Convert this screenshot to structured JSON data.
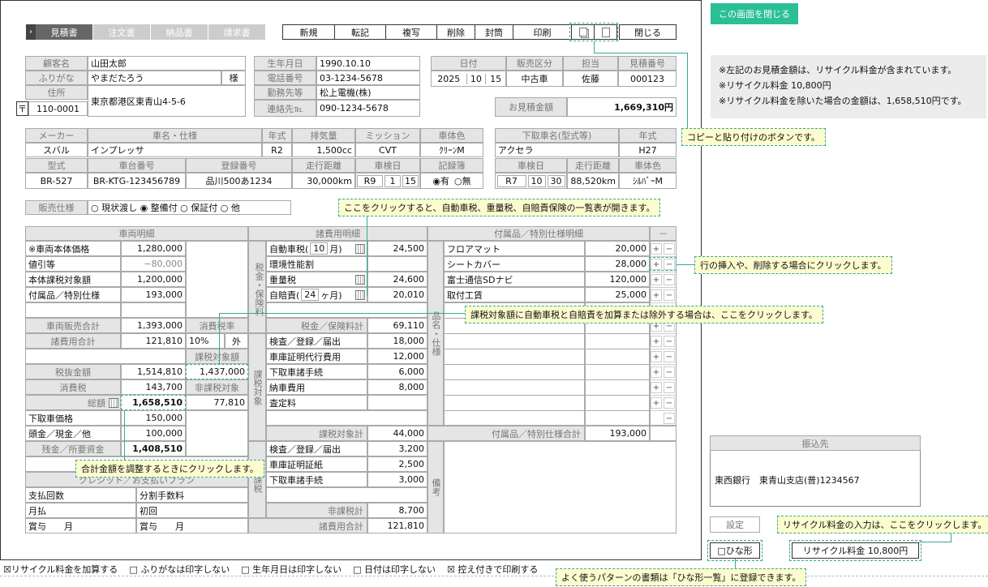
{
  "close_screen": "この画面を閉じる",
  "tabs": [
    "見積書",
    "注文書",
    "納品書",
    "請求書"
  ],
  "toolbar": [
    "新規",
    "転記",
    "複写",
    "削除",
    "封筒",
    "印刷",
    "閉じる"
  ],
  "customer": {
    "name_lbl": "顧客名",
    "name": "山田太郎",
    "kana_lbl": "ふりがな",
    "kana": "やまだたろう",
    "sama": "様",
    "addr_lbl": "住所",
    "zip_mark": "〒",
    "zip": "110-0001",
    "addr": "東京都港区東青山4-5-6",
    "birth_lbl": "生年月日",
    "birth": "1990.10.10",
    "tel_lbl": "電話番号",
    "tel": "03-1234-5678",
    "work_lbl": "勤務先等",
    "work": "松上電機(株)",
    "contact_lbl": "連絡先℡",
    "contact": "090-1234-5678"
  },
  "order": {
    "date_lbl": "日付",
    "y": "2025",
    "m": "10",
    "d": "15",
    "kubun_lbl": "販売区分",
    "kubun": "中古車",
    "tanto_lbl": "担当",
    "tanto": "佐藤",
    "no_lbl": "見積番号",
    "no": "000123",
    "amount_lbl": "お見積金額",
    "amount": "1,669,310円"
  },
  "car": {
    "maker_lbl": "メーカー",
    "maker": "スバル",
    "name_lbl": "車名・仕様",
    "name": "インプレッサ",
    "year_lbl": "年式",
    "year": "R2",
    "cc_lbl": "排気量",
    "cc": "1,500cc",
    "mission_lbl": "ミッション",
    "mission": "CVT",
    "color_lbl": "車体色",
    "color": "ｸﾘｰﾝM",
    "type_lbl": "型式",
    "type": "BR-527",
    "frame_lbl": "車台番号",
    "frame": "BR-KTG-123456789",
    "reg_lbl": "登録番号",
    "reg": "品川500あ1234",
    "km_lbl": "走行距離",
    "km": "30,000km",
    "inspect_lbl": "車検日",
    "ins_y": "R9",
    "ins_m": "1",
    "ins_d": "15",
    "rec_lbl": "記録簿",
    "rec_yes": "◉有",
    "rec_no": "○無"
  },
  "trade": {
    "name_lbl": "下取車名(型式等)",
    "name": "アクセラ",
    "year_lbl": "年式",
    "year": "H27",
    "ins_lbl": "車検日",
    "ins_y": "R7",
    "ins_m": "10",
    "ins_d": "30",
    "km_lbl": "走行距離",
    "km": "88,520km",
    "color_lbl": "車体色",
    "color": "ｼﾙﾊﾞｰM"
  },
  "sales": {
    "lbl": "販売仕様",
    "opts": "○ 現状渡し ◉ 整備付 ○ 保証付 ○ 他"
  },
  "head": {
    "car": "車両明細",
    "fee": "諸費用明細",
    "acc": "付属品／特別仕様明細",
    "minus": "－"
  },
  "carrows": [
    [
      "※車両本体価格",
      "1,280,000"
    ],
    [
      "値引等",
      "−80,000"
    ],
    [
      "本体課税対象額",
      "1,200,000"
    ],
    [
      "付属品／特別仕様",
      "193,000"
    ]
  ],
  "sum": {
    "hanbai_lbl": "車両販売合計",
    "hanbai": "1,393,000",
    "shohi_rate_lbl": "消費税率",
    "shohi_rate": "10%",
    "soto": "外",
    "shohiyo_lbl": "諸費用合計",
    "shohiyo": "121,810",
    "kazei_lbl": "課税対象額",
    "kazei": "1,437,000",
    "nuki_lbl": "税抜金額",
    "nuki": "1,514,810",
    "tax_lbl": "消費税",
    "tax": "143,700",
    "hikazei_lbl": "非課税対象",
    "hikazei": "77,810",
    "total_lbl": "総額",
    "total": "1,658,510",
    "shita_lbl": "下取車価格",
    "shita": "150,000",
    "atama_lbl": "頭金／現金／他",
    "atama": "100,000",
    "zan_lbl": "残金／所要資金",
    "zan": "1,408,510",
    "credit_lbl": "クレジット／お支払いプラン",
    "kaisu": "支払回数",
    "tesuryo": "分割手数料",
    "tsuki": "月払",
    "shokai": "初回",
    "shoyo1": "賞与　　月",
    "shoyo2": "賞与　　月"
  },
  "fees": {
    "side1": "税金・保険料",
    "jido": "自動車税(",
    "jido_m": "10",
    "jido_u": "月)",
    "jido_v": "24,500",
    "kankyo": "環境性能割",
    "juryo": "重量税",
    "juryo_v": "24,600",
    "jibai": "自賠責(",
    "jibai_m": "24",
    "jibai_u": "ヶ月)",
    "jibai_v": "20,010",
    "tax_total_lbl": "税金／保険料計",
    "tax_total": "69,110",
    "side2": "課税対象",
    "k1": "検査／登録／届出",
    "k1v": "18,000",
    "k2": "車庫証明代行費用",
    "k2v": "12,000",
    "k3": "下取車諸手続",
    "k3v": "6,000",
    "k4": "納車費用",
    "k4v": "8,000",
    "k5": "査定料",
    "kazei_total_lbl": "課税対象計",
    "kazei_total": "44,000",
    "side3": "非課税",
    "h1": "検査／登録／届出",
    "h1v": "3,200",
    "h2": "車庫証明証紙",
    "h2v": "2,500",
    "h3": "下取車諸手続",
    "h3v": "3,000",
    "hikazei_total_lbl": "非課税計",
    "hikazei_total": "8,700",
    "all_lbl": "諸費用合計",
    "all": "121,810"
  },
  "acc": {
    "side": "品名・仕様",
    "items": [
      [
        "フロアマット",
        "20,000"
      ],
      [
        "シートカバー",
        "28,000"
      ],
      [
        "富士通信SDナビ",
        "120,000"
      ],
      [
        "取付工賃",
        "25,000"
      ]
    ],
    "total_lbl": "付属品／特別仕様合計",
    "total": "193,000",
    "biko": "備考"
  },
  "notes": [
    "※左記のお見積金額は、リサイクル料金が含まれています。",
    "※リサイクル料金 10,800円",
    "※リサイクル料金を除いた場合の金額は、1,658,510円です。"
  ],
  "bank": {
    "lbl": "振込先",
    "text": "東西銀行　東青山支店(普)1234567"
  },
  "settei": "設定",
  "hinagata": "□ひな形",
  "recycle": "リサイクル料金 10,800円",
  "bottom": [
    "☒リサイクル料金を加算する",
    "□ ふりがなは印字しない",
    "□ 生年月日は印字しない",
    "□ 日付は印字しない",
    "☒ 控え付きで印刷する"
  ],
  "tips": {
    "copy": "コピーと貼り付けのボタンです。",
    "list": "ここをクリックすると、自動車税、重量税、自賠責保険の一覧表が開きます。",
    "row": "行の挿入や、削除する場合にクリックします。",
    "kazei": "課税対象額に自動車税と自賠責を加算または除外する場合は、ここをクリックします。",
    "total": "合計金額を調整するときにクリックします。",
    "recycle": "リサイクル料金の入力は、ここをクリックします。",
    "hina": "よく使うパターンの書類は「ひな形一覧」に登録できます。"
  }
}
